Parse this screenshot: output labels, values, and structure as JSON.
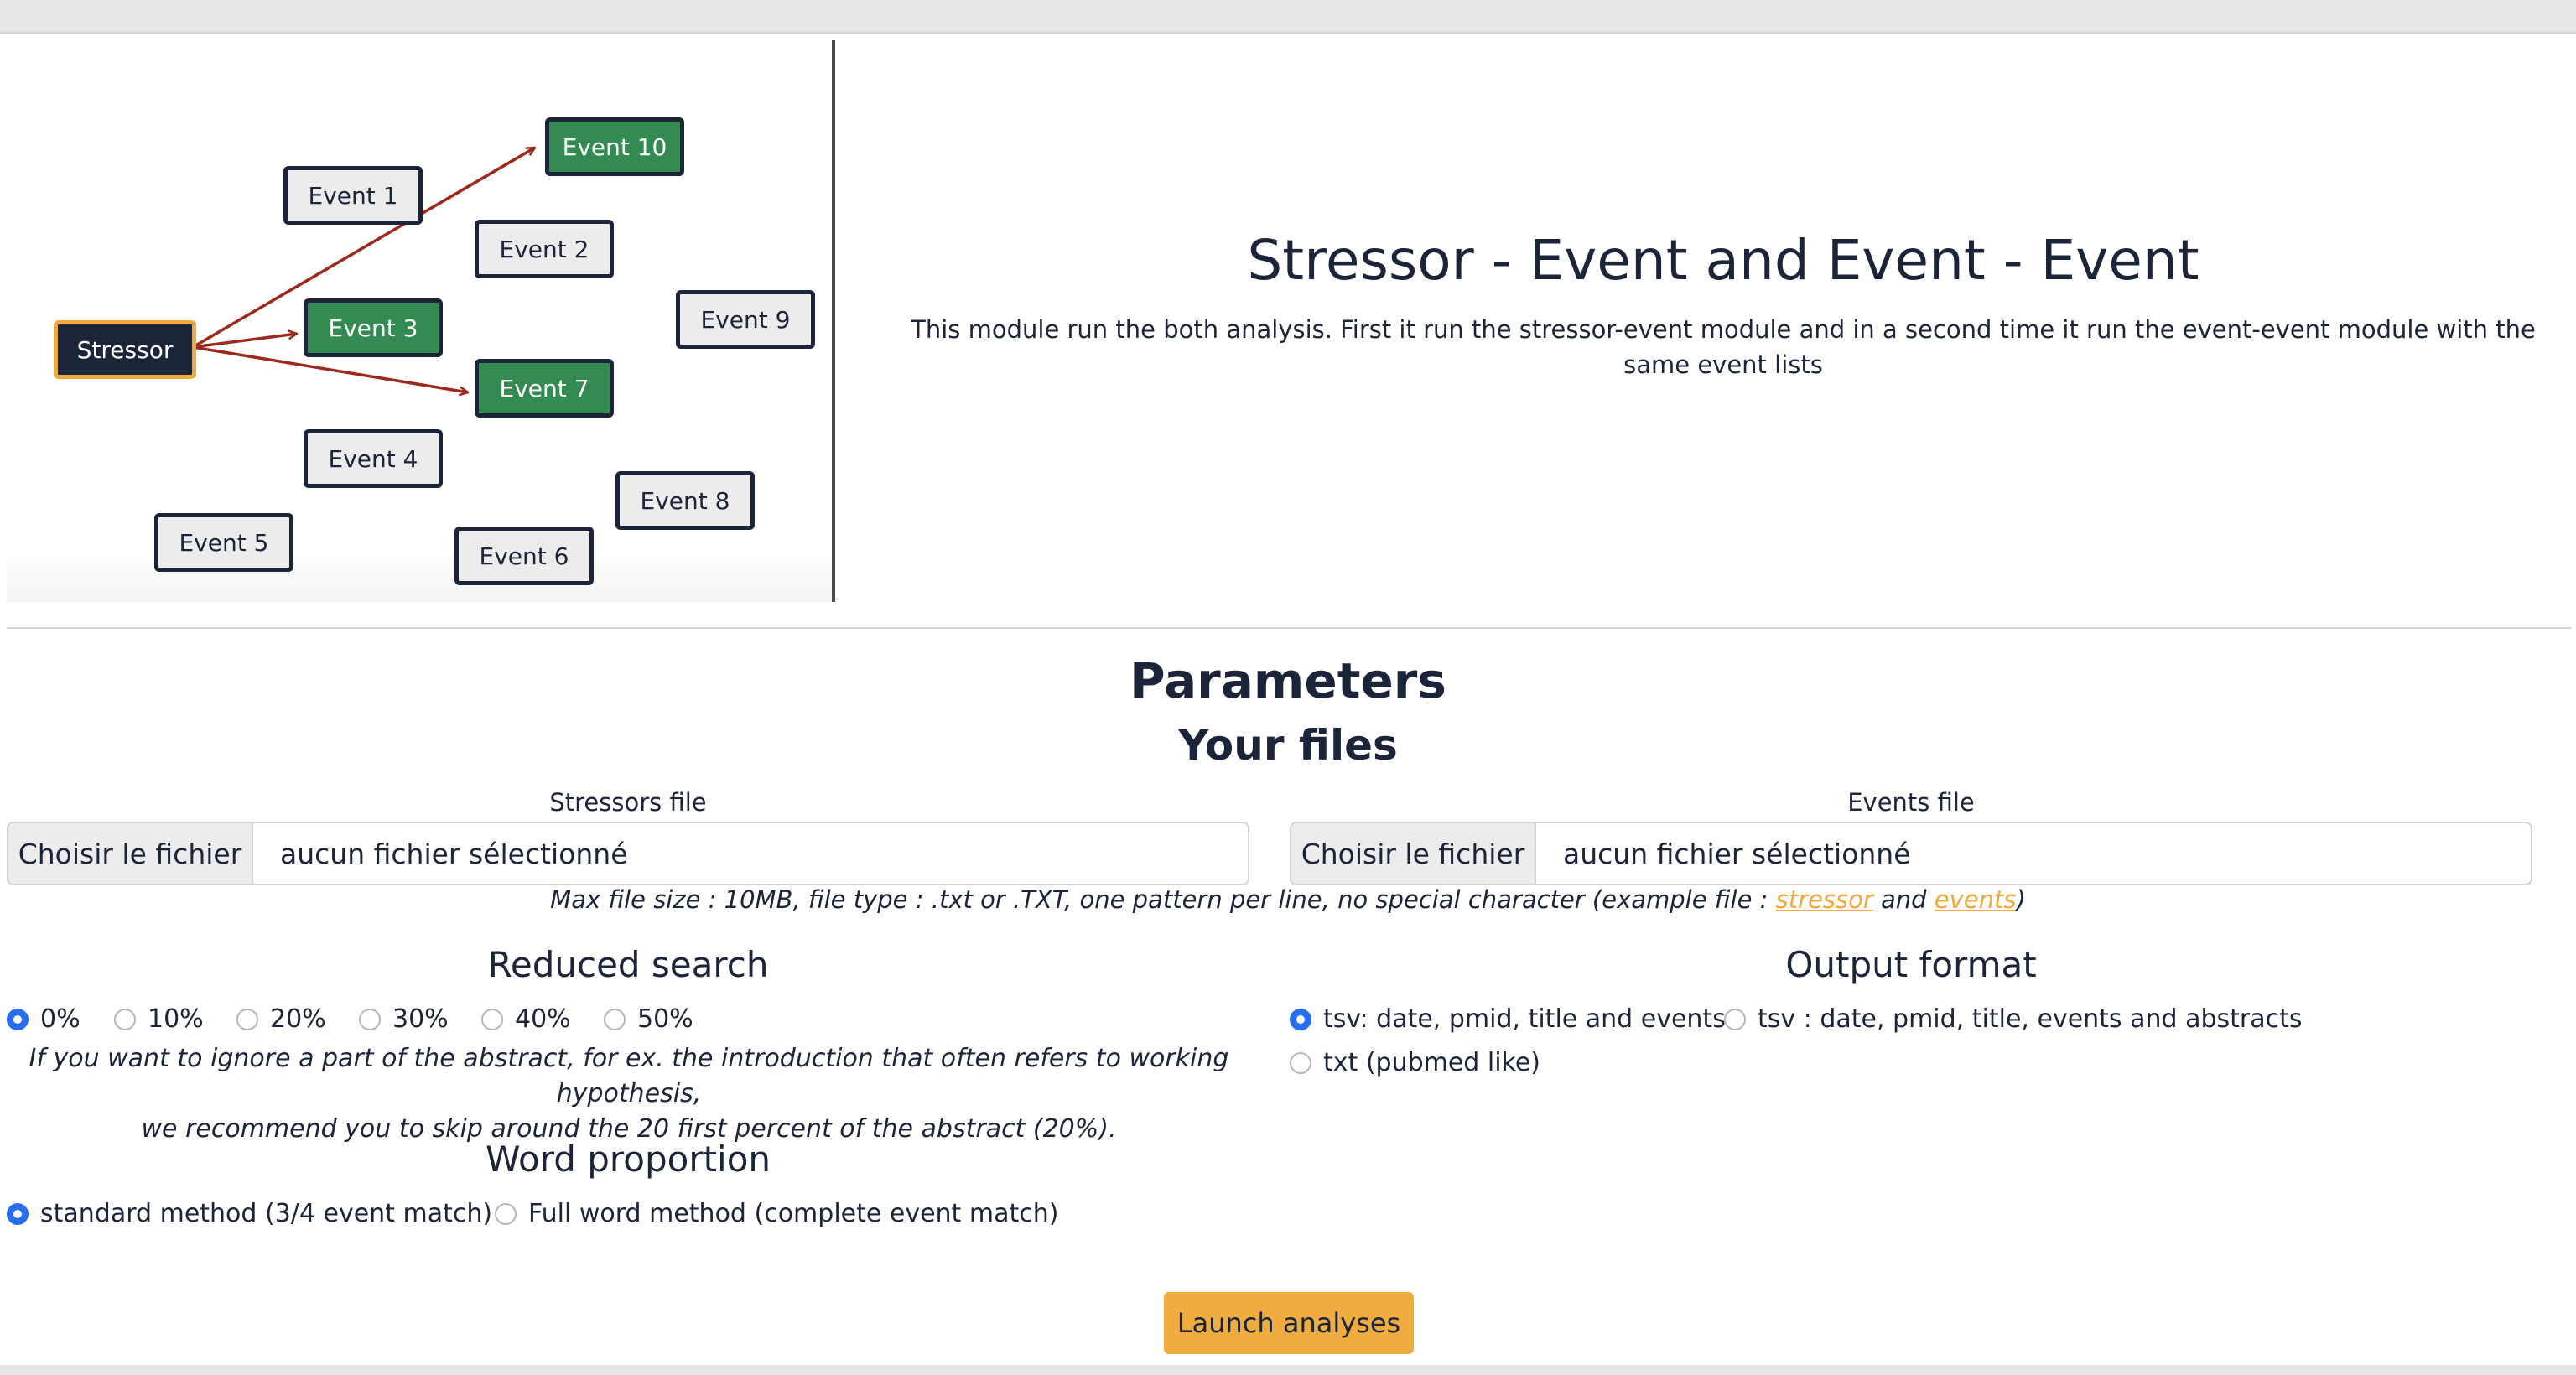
{
  "diagram": {
    "stressor": "Stressor",
    "events": {
      "e1": "Event 1",
      "e2": "Event 2",
      "e3": "Event 3",
      "e4": "Event 4",
      "e5": "Event 5",
      "e6": "Event 6",
      "e7": "Event 7",
      "e8": "Event 8",
      "e9": "Event 9",
      "e10": "Event 10"
    },
    "colors": {
      "matched": "#338b52",
      "stressor_bg": "#1b2438",
      "stressor_border": "#f0a93b",
      "arrow": "#9c2a1c"
    }
  },
  "header": {
    "title": "Stressor - Event and Event - Event",
    "description": "This module run the both analysis. First it run the stressor-event module and in a second time it run the event-event module with the same event lists"
  },
  "parameters": {
    "title": "Parameters",
    "files_title": "Your files",
    "stressors_file": {
      "label": "Stressors file",
      "button": "Choisir le fichier",
      "value": "aucun fichier sélectionné"
    },
    "events_file": {
      "label": "Events file",
      "button": "Choisir le fichier",
      "value": "aucun fichier sélectionné"
    },
    "hint": {
      "prefix": "Max file size : 10MB, file type : .txt or .TXT, one pattern per line, no special character (example file : ",
      "stressor_link": "stressor",
      "and": " and ",
      "events_link": "events",
      "suffix": ")"
    },
    "reduced_search": {
      "title": "Reduced search",
      "options": [
        "0%",
        "10%",
        "20%",
        "30%",
        "40%",
        "50%"
      ],
      "selected": "0%",
      "note_line1": "If you want to ignore a part of the abstract, for ex. the introduction that often refers to working hypothesis,",
      "note_line2": "we recommend you to skip around the 20 first percent of the abstract (20%)."
    },
    "output_format": {
      "title": "Output format",
      "options": [
        "tsv: date, pmid, title and events",
        "tsv : date, pmid, title, events and abstracts",
        "txt (pubmed like)"
      ],
      "selected": "tsv: date, pmid, title and events"
    },
    "word_proportion": {
      "title": "Word proportion",
      "options": [
        "standard method (3/4 event match)",
        "Full word method (complete event match)"
      ],
      "selected": "standard method (3/4 event match)"
    },
    "launch_label": "Launch analyses"
  },
  "accent_color": "#f1ac3f",
  "radio_color": "#2a6ef0"
}
